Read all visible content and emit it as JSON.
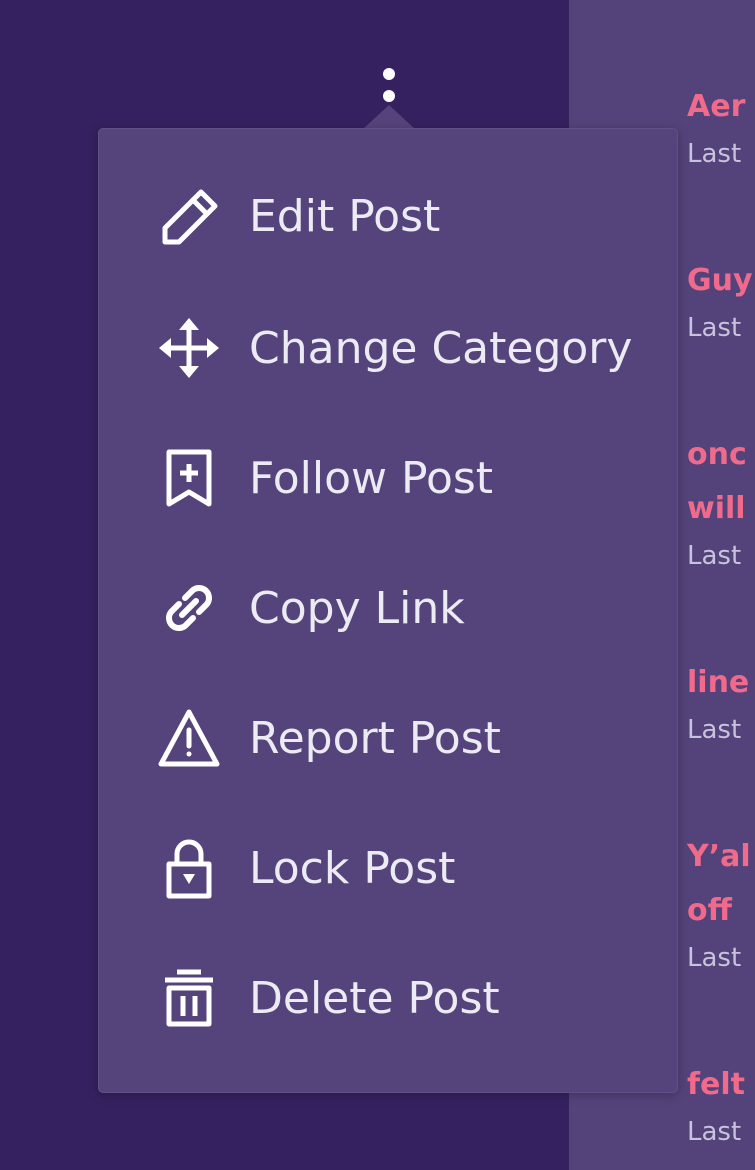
{
  "menu": {
    "items": [
      {
        "label": "Edit Post",
        "icon": "pencil-icon"
      },
      {
        "label": "Change Category",
        "icon": "move-arrows-icon"
      },
      {
        "label": "Follow Post",
        "icon": "bookmark-plus-icon"
      },
      {
        "label": "Copy Link",
        "icon": "link-icon"
      },
      {
        "label": "Report Post",
        "icon": "warning-triangle-icon"
      },
      {
        "label": "Lock Post",
        "icon": "lock-icon"
      },
      {
        "label": "Delete Post",
        "icon": "trash-icon"
      }
    ]
  },
  "feed": {
    "items": [
      {
        "title_lines": [
          "Aer"
        ],
        "meta": "Last"
      },
      {
        "title_lines": [
          "Guy"
        ],
        "meta": "Last"
      },
      {
        "title_lines": [
          "onc",
          "will"
        ],
        "meta": "Last"
      },
      {
        "title_lines": [
          "line"
        ],
        "meta": "Last"
      },
      {
        "title_lines": [
          "Y’al",
          "off "
        ],
        "meta": "Last"
      },
      {
        "title_lines": [
          "felt"
        ],
        "meta": "Last"
      }
    ]
  },
  "colors": {
    "background": "#35215f",
    "panel": "#53437a",
    "menu": "#55447b",
    "accent_title": "#f06a8c",
    "menu_text": "#ecebf3"
  }
}
